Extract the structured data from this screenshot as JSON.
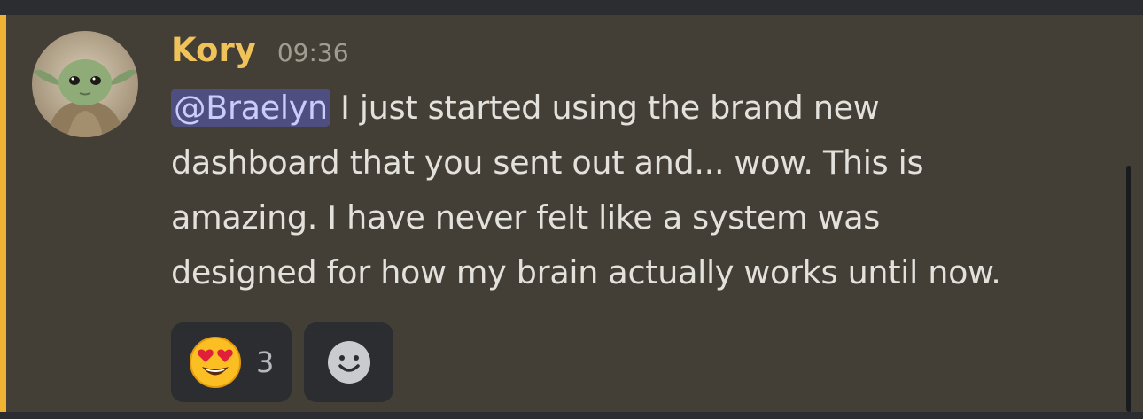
{
  "message": {
    "author": "Kory",
    "timestamp": "09:36",
    "mention": "@Braelyn",
    "lines": [
      " I just started using the brand new",
      "dashboard that you sent out and... wow. This is",
      "amazing. I have never felt like a system was",
      "designed for how my brain actually works until now."
    ]
  },
  "reactions": [
    {
      "emoji": "smiling-face-with-heart-eyes",
      "count": "3"
    },
    {
      "emoji": "add-reaction-smiley"
    }
  ],
  "colors": {
    "accent": "#f0b232",
    "username": "#f0c35a",
    "mention_bg": "#4e4f80",
    "mention_text": "#c9cdfb",
    "message_bg": "#433f36"
  }
}
